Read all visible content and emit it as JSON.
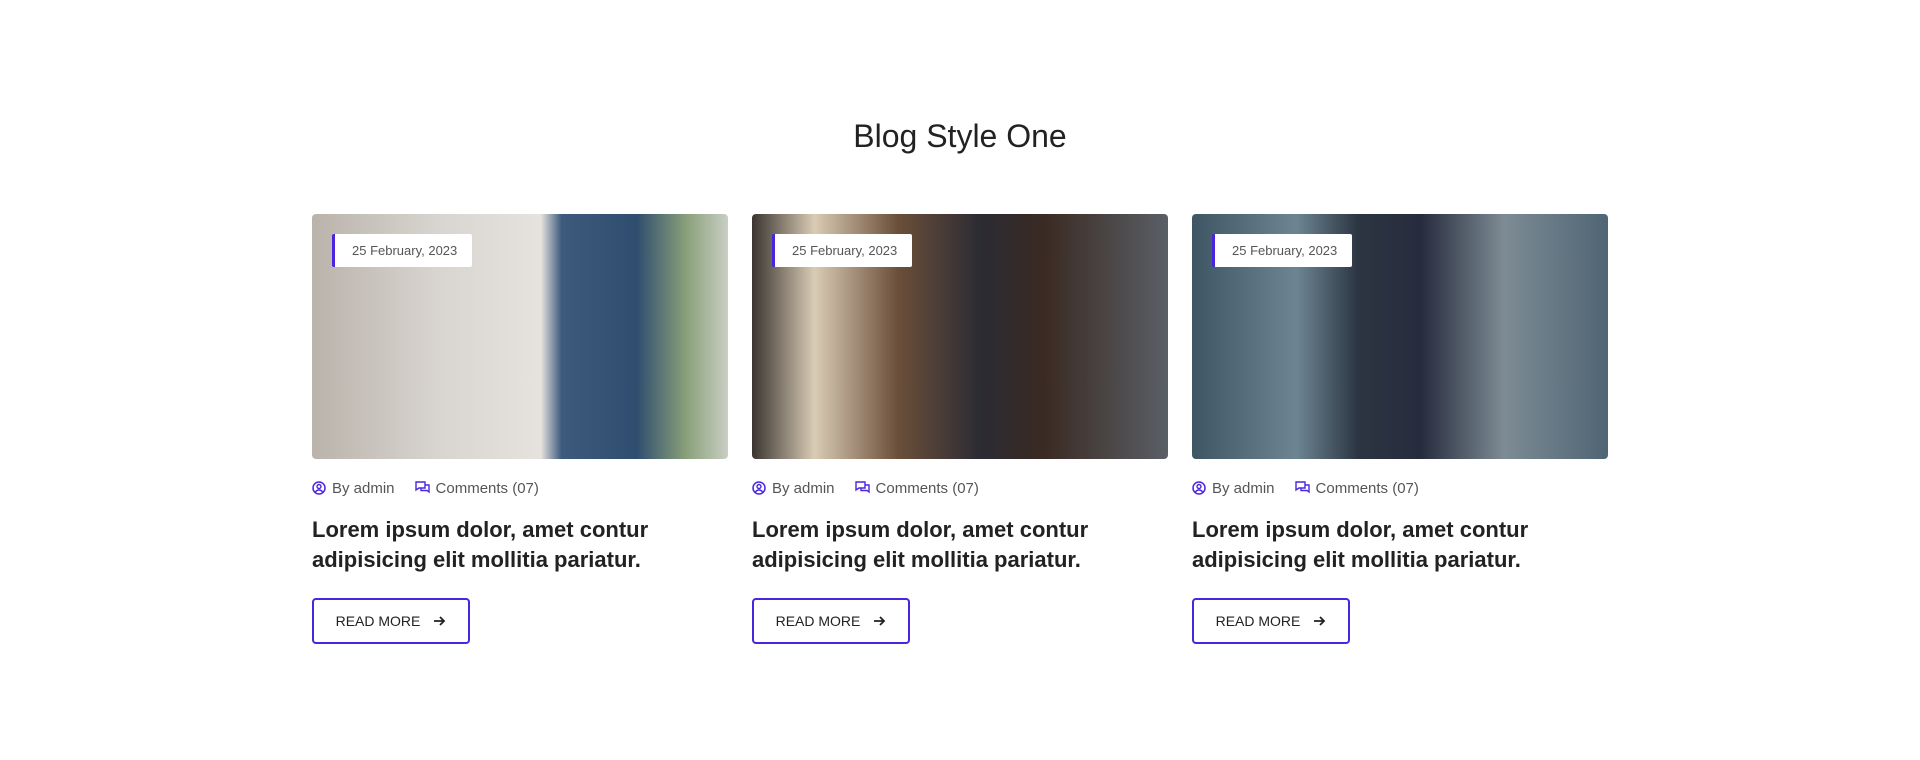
{
  "heading": "Blog Style One",
  "posts": [
    {
      "date": "25 February, 2023",
      "author": "By admin",
      "comments": "Comments (07)",
      "title": "Lorem ipsum dolor, amet contur adipisicing elit mollitia pariatur.",
      "button": "READ MORE"
    },
    {
      "date": "25 February, 2023",
      "author": "By admin",
      "comments": "Comments (07)",
      "title": "Lorem ipsum dolor, amet contur adipisicing elit mollitia pariatur.",
      "button": "READ MORE"
    },
    {
      "date": "25 February, 2023",
      "author": "By admin",
      "comments": "Comments (07)",
      "title": "Lorem ipsum dolor, amet contur adipisicing elit mollitia pariatur.",
      "button": "READ MORE"
    }
  ],
  "colors": {
    "accent": "#4a25e0",
    "text": "#222222"
  }
}
